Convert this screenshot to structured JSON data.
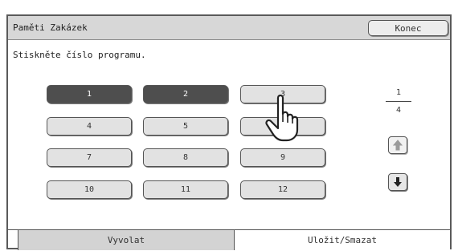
{
  "window": {
    "title": "Paměti Zakázek",
    "close_label": "Konec"
  },
  "instruction": "Stiskněte číslo programu.",
  "programs": [
    "1",
    "2",
    "3",
    "4",
    "5",
    "6",
    "7",
    "8",
    "9",
    "10",
    "11",
    "12"
  ],
  "selected_programs": [
    "1",
    "2"
  ],
  "pagination": {
    "current": "1",
    "total": "4"
  },
  "icons": {
    "up": "arrow-up-icon",
    "down": "arrow-down-icon",
    "pointer": "hand-pointer-icon"
  },
  "tabs": [
    {
      "label": "Vyvolat"
    },
    {
      "label": "Uložit/Smazat",
      "active": true
    }
  ],
  "colors": {
    "selected_button": "#4e4e4e",
    "button": "#e2e2e2",
    "title_bar": "#d7d7d7"
  }
}
